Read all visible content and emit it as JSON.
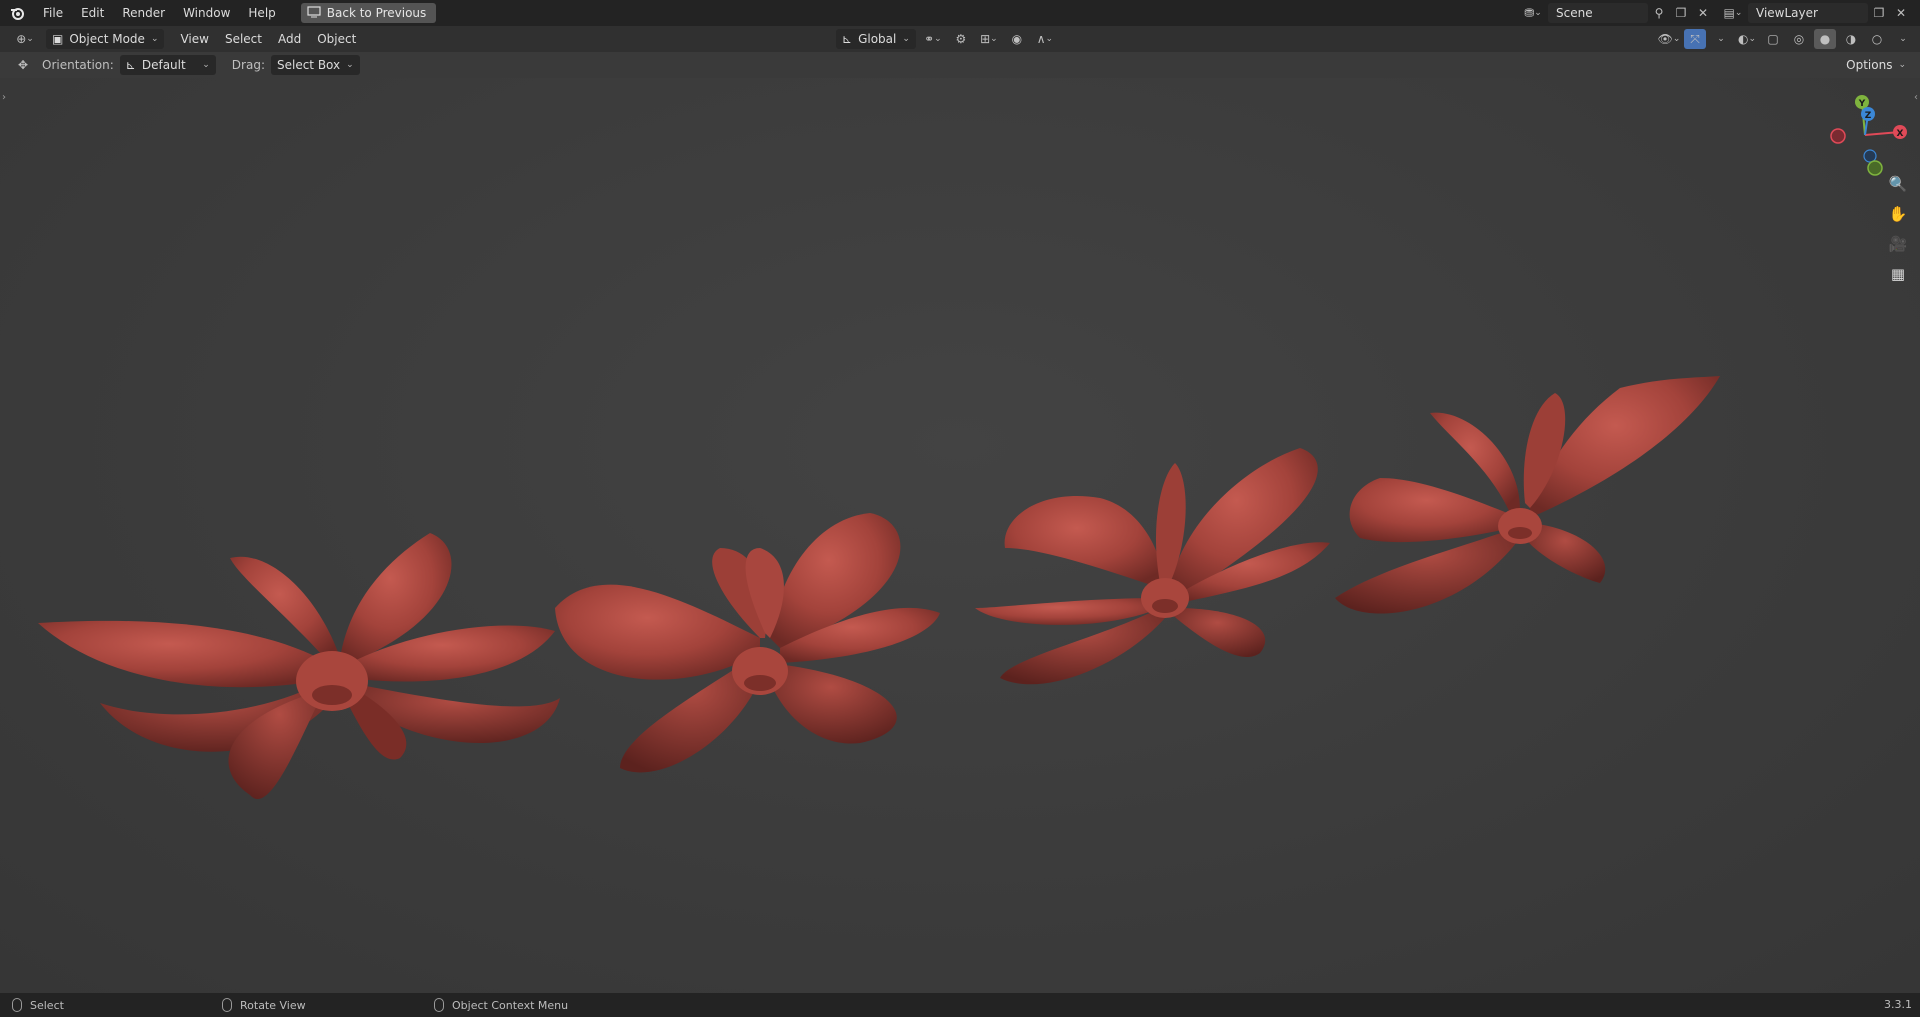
{
  "topbar": {
    "menus": [
      "File",
      "Edit",
      "Render",
      "Window",
      "Help"
    ],
    "back_button": "Back to Previous",
    "scene_name": "Scene",
    "view_layer": "ViewLayer"
  },
  "header": {
    "mode": "Object Mode",
    "menus": [
      "View",
      "Select",
      "Add",
      "Object"
    ],
    "transform_orientation": "Global"
  },
  "tool_settings": {
    "orientation_label": "Orientation:",
    "orientation_value": "Default",
    "drag_label": "Drag:",
    "drag_value": "Select Box",
    "options_label": "Options"
  },
  "gizmo": {
    "x_label": "X",
    "y_label": "Y",
    "z_label": "Z",
    "colors": {
      "x": "#e04a58",
      "y": "#7fb43e",
      "z": "#3b87d6"
    }
  },
  "viewport": {
    "object_color": "#a8413a",
    "object_count": 4
  },
  "statusbar": {
    "select": "Select",
    "rotate_view": "Rotate View",
    "context_menu": "Object Context Menu",
    "version": "3.3.1"
  }
}
